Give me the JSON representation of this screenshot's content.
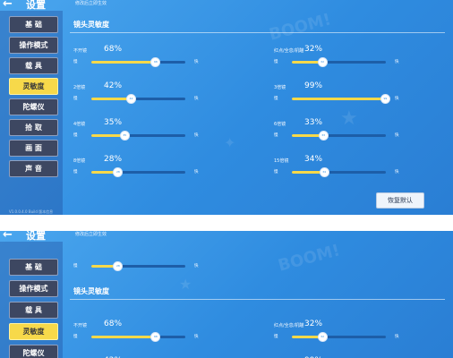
{
  "header": {
    "back_icon": "←",
    "title": "设置",
    "hint": "修改后立即生效"
  },
  "sidebar": {
    "items": [
      {
        "label": "基 础"
      },
      {
        "label": "操作模式"
      },
      {
        "label": "载 具"
      },
      {
        "label": "灵敏度",
        "active": true
      },
      {
        "label": "陀螺仪"
      },
      {
        "label": "拾 取"
      },
      {
        "label": "画 面"
      },
      {
        "label": "声 音"
      }
    ],
    "version": "V1.0.0.4.0 Build 版本信息"
  },
  "section": {
    "title": "镜头灵敏度"
  },
  "sliders": [
    {
      "name": "不开镜",
      "value": "68%",
      "level": 68
    },
    {
      "name": "红点/全息/机瞄",
      "value": "32%",
      "level": 32
    },
    {
      "name": "2倍镜",
      "value": "42%",
      "level": 42
    },
    {
      "name": "3倍镜",
      "value": "99%",
      "level": 99
    },
    {
      "name": "4倍镜",
      "value": "35%",
      "level": 35
    },
    {
      "name": "6倍镜",
      "value": "33%",
      "level": 33
    },
    {
      "name": "8倍镜",
      "value": "28%",
      "level": 28
    },
    {
      "name": "15倍镜",
      "value": "34%",
      "level": 34
    }
  ],
  "slider_min_label": "慢",
  "slider_max_label": "快",
  "restore_button": "恢复默认",
  "accent": "#f7d94a",
  "bg": "#3a97e8"
}
